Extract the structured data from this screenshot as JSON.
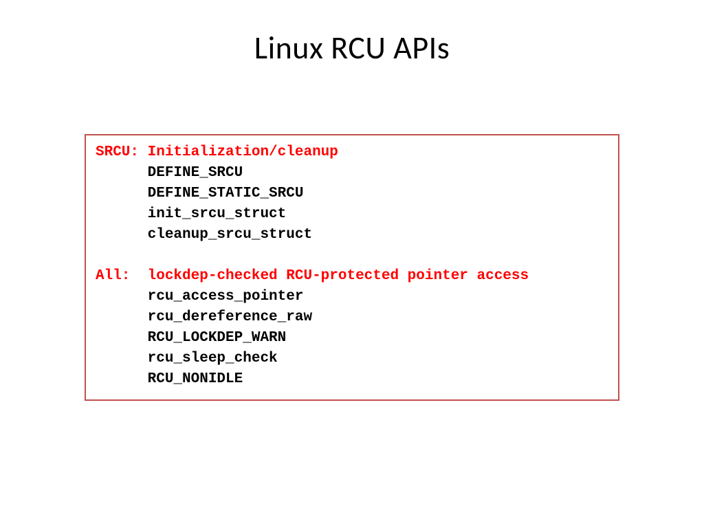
{
  "title": "Linux RCU APIs",
  "sections": [
    {
      "label": "SRCU:",
      "heading": "Initialization/cleanup",
      "items": [
        "DEFINE_SRCU",
        "DEFINE_STATIC_SRCU",
        "init_srcu_struct",
        "cleanup_srcu_struct"
      ]
    },
    {
      "label": "All:",
      "heading": "lockdep-checked RCU-protected pointer access",
      "items": [
        "rcu_access_pointer",
        "rcu_dereference_raw",
        "RCU_LOCKDEP_WARN",
        "rcu_sleep_check",
        "RCU_NONIDLE"
      ]
    }
  ]
}
